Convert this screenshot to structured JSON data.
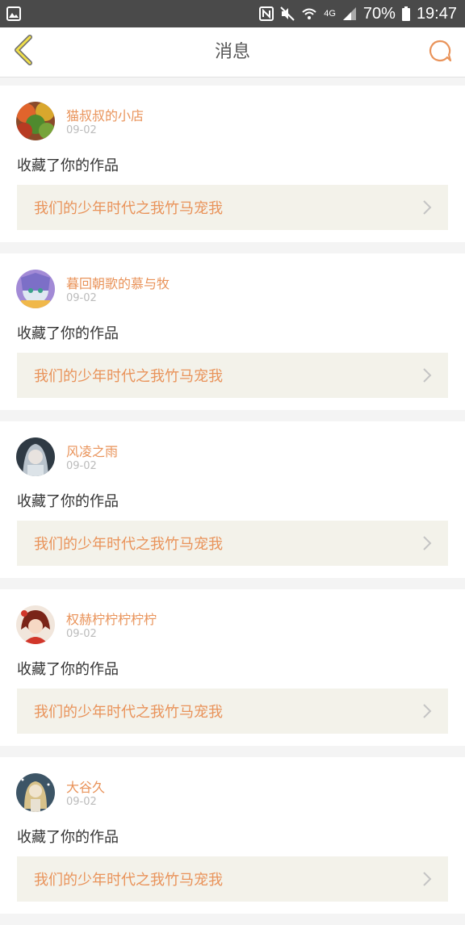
{
  "status_bar": {
    "battery": "70%",
    "time": "19:47",
    "network": "4G"
  },
  "header": {
    "title": "消息",
    "accent_color": "#e9935a",
    "back_icon": "chevron-left-icon",
    "chat_icon": "chat-bubble-icon"
  },
  "messages": [
    {
      "username": "猫叔叔的小店",
      "date": "09-02",
      "action": "收藏了你的作品",
      "work_title": "我们的少年时代之我竹马宠我"
    },
    {
      "username": "暮回朝歌的慕与牧",
      "date": "09-02",
      "action": "收藏了你的作品",
      "work_title": "我们的少年时代之我竹马宠我"
    },
    {
      "username": "风凌之雨",
      "date": "09-02",
      "action": "收藏了你的作品",
      "work_title": "我们的少年时代之我竹马宠我"
    },
    {
      "username": "权赫柠柠柠柠柠",
      "date": "09-02",
      "action": "收藏了你的作品",
      "work_title": "我们的少年时代之我竹马宠我"
    },
    {
      "username": "大谷久",
      "date": "09-02",
      "action": "收藏了你的作品",
      "work_title": "我们的少年时代之我竹马宠我"
    }
  ]
}
